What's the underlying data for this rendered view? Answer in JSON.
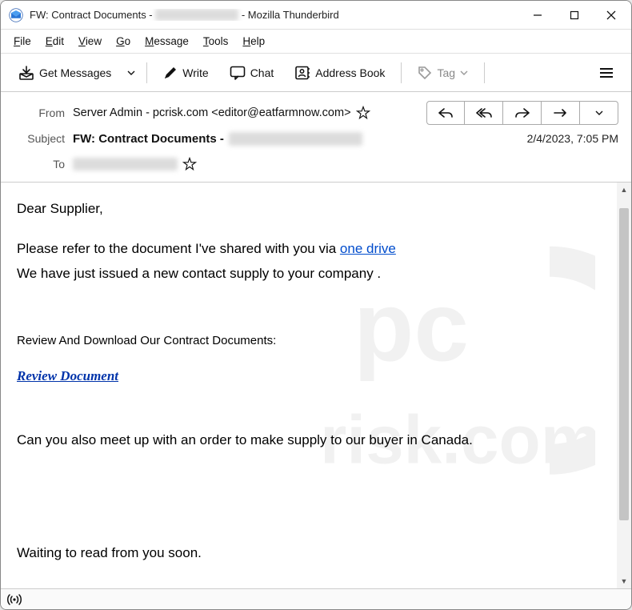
{
  "window": {
    "title_prefix": "FW: Contract Documents - ",
    "title_suffix": " - Mozilla Thunderbird"
  },
  "menu": {
    "file": "File",
    "edit": "Edit",
    "view": "View",
    "go": "Go",
    "message": "Message",
    "tools": "Tools",
    "help": "Help"
  },
  "toolbar": {
    "get": "Get Messages",
    "write": "Write",
    "chat": "Chat",
    "addressbook": "Address Book",
    "tag": "Tag"
  },
  "headers": {
    "from_label": "From",
    "from_value": "Server Admin - pcrisk.com <editor@eatfarmnow.com>",
    "subject_label": "Subject",
    "subject_value": "FW: Contract Documents - ",
    "date": "2/4/2023, 7:05 PM",
    "to_label": "To"
  },
  "body": {
    "greeting": "Dear Supplier,",
    "p1a": "Please refer to the document I've shared with you via  ",
    "p1link": " one drive",
    "p2": "We have just issued a new contact supply to your company .",
    "p3": "Review And Download Our Contract Documents:",
    "p4link": " Review Document",
    "p5": "Can you also meet up with an order to make supply to our buyer in Canada.",
    "p6": "Waiting to read from you soon."
  }
}
